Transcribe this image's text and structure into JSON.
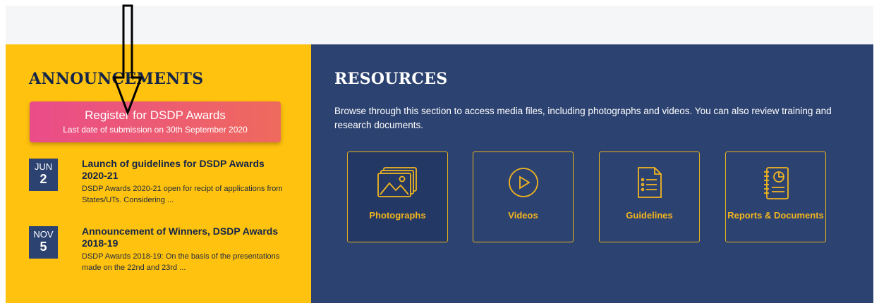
{
  "announcements": {
    "heading": "ANNOUNCEMENTS",
    "register": {
      "title": "Register for DSDP Awards",
      "subtitle": "Last date of submission on 30th September 2020"
    },
    "items": [
      {
        "month": "JUN",
        "day": "2",
        "title": "Launch of guidelines for DSDP Awards 2020-21",
        "description": "DSDP Awards 2020-21 open for recipt of applications from States/UTs. Considering ..."
      },
      {
        "month": "NOV",
        "day": "5",
        "title": "Announcement of Winners, DSDP Awards 2018-19",
        "description": "DSDP Awards 2018-19: On the basis of the presentations made on the 22nd and 23rd ..."
      }
    ]
  },
  "resources": {
    "heading": "RESOURCES",
    "description": "Browse through this section to access media files, including photographs and videos. You can also review training and research documents.",
    "tiles": [
      {
        "label": "Photographs",
        "icon": "photographs-icon"
      },
      {
        "label": "Videos",
        "icon": "play-icon"
      },
      {
        "label": "Guidelines",
        "icon": "guidelines-document-icon"
      },
      {
        "label": "Reports & Documents",
        "icon": "reports-notebook-icon"
      }
    ]
  },
  "colors": {
    "announcements_bg": "#ffc20e",
    "resources_bg": "#2c4270",
    "accent_gold": "#f2b51f",
    "register_gradient_start": "#ea4c89",
    "register_gradient_end": "#ef6a5d"
  },
  "annotation": {
    "icon": "down-arrow-annotation-icon"
  }
}
